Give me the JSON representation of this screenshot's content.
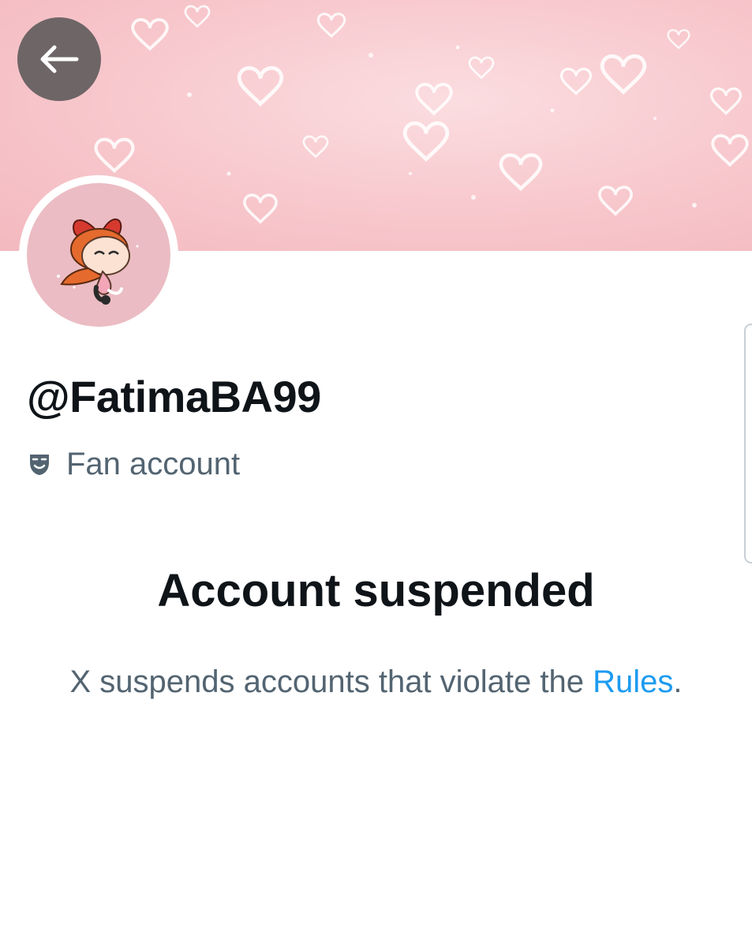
{
  "header": {
    "back_icon": "arrow-left-icon"
  },
  "profile": {
    "handle": "@FatimaBA99",
    "label_icon": "drama-masks-icon",
    "label_text": "Fan account"
  },
  "suspension": {
    "title": "Account suspended",
    "message_prefix": "X suspends accounts that violate the ",
    "rules_link": "Rules",
    "message_suffix": "."
  },
  "colors": {
    "banner_pink": "#f7c7cc",
    "avatar_pink": "#ebbcc3",
    "text_primary": "#0f1419",
    "text_secondary": "#536471",
    "link_blue": "#1d9bf0",
    "back_button_bg": "#6e6566"
  }
}
